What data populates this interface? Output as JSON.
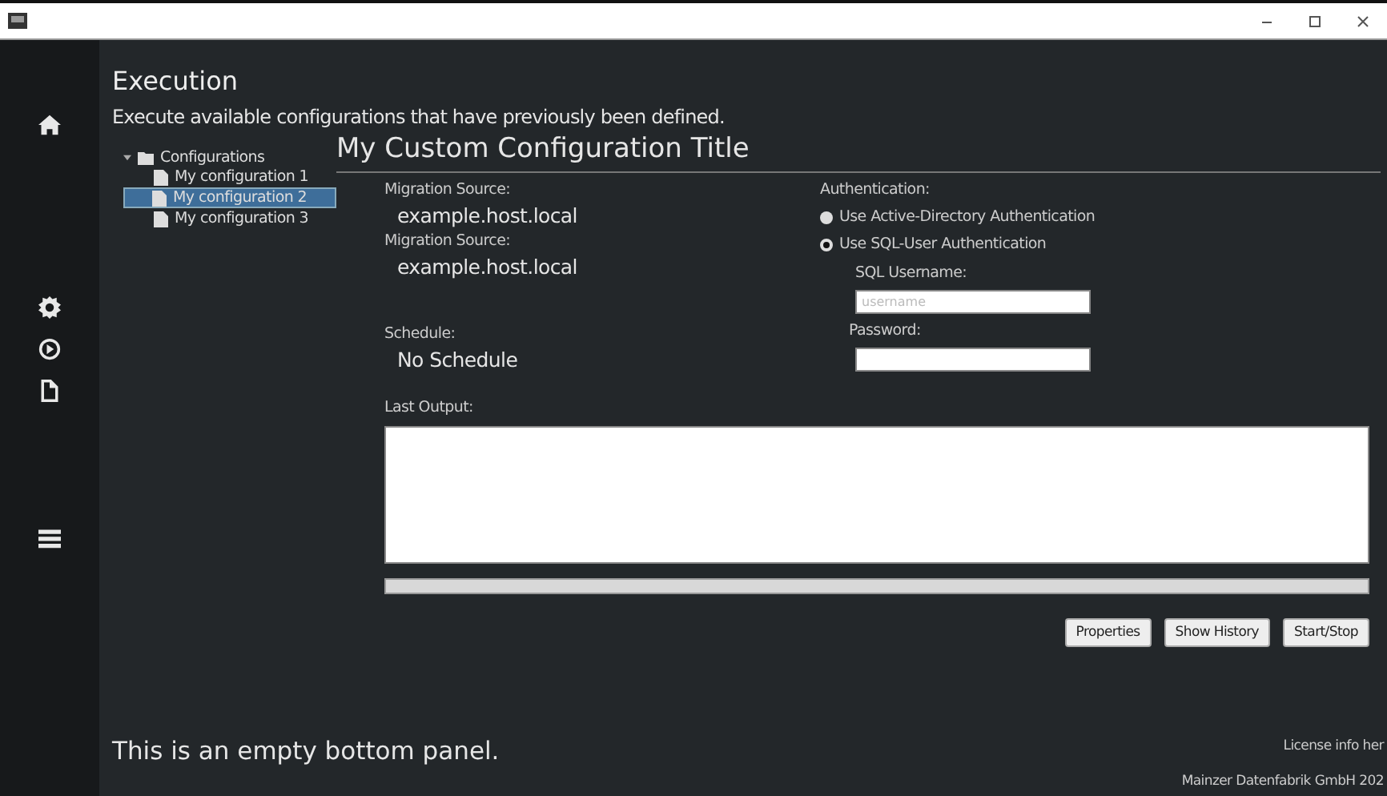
{
  "window": {
    "controls": [
      {
        "kind": "minimize"
      },
      {
        "kind": "maximize"
      },
      {
        "kind": "close"
      }
    ]
  },
  "sidebar": {
    "items": [
      {
        "kind": "home"
      },
      {
        "kind": "gear"
      },
      {
        "kind": "play"
      },
      {
        "kind": "file"
      },
      {
        "kind": "menu"
      }
    ]
  },
  "header": {
    "title": "Execution",
    "subtitle": "Execute available configurations that have previously been defined."
  },
  "tree": {
    "label": "Configurations",
    "expanded": true,
    "children": [
      {
        "label": "My configuration 1",
        "selected": false
      },
      {
        "label": "My configuration 2",
        "selected": true
      },
      {
        "label": "My configuration 3",
        "selected": false
      }
    ]
  },
  "detail": {
    "title": "My Custom Configuration Title",
    "left": [
      {
        "label": "Migration Source:",
        "value": "example.host.local"
      },
      {
        "label": "Migration Source:",
        "value": "example.host.local"
      },
      {
        "label": "Schedule:",
        "value": "No Schedule"
      }
    ],
    "auth": {
      "label": "Authentication:",
      "options": [
        {
          "label": "Use Active-Directory Authentication",
          "selected": false
        },
        {
          "label": "Use SQL-User Authentication",
          "selected": true
        }
      ],
      "fields": [
        {
          "label": "SQL Username:",
          "placeholder": "username"
        },
        {
          "label": "Password:"
        }
      ]
    },
    "output": {
      "label": "Last Output:"
    },
    "progress": {
      "level": 1
    },
    "buttons": [
      "Properties",
      "Show History",
      "Start/Stop"
    ]
  },
  "bottom_panel": {
    "text": "This is an empty bottom panel.",
    "footer": [
      "License info her",
      "Mainzer Datenfabrik GmbH 202"
    ]
  }
}
